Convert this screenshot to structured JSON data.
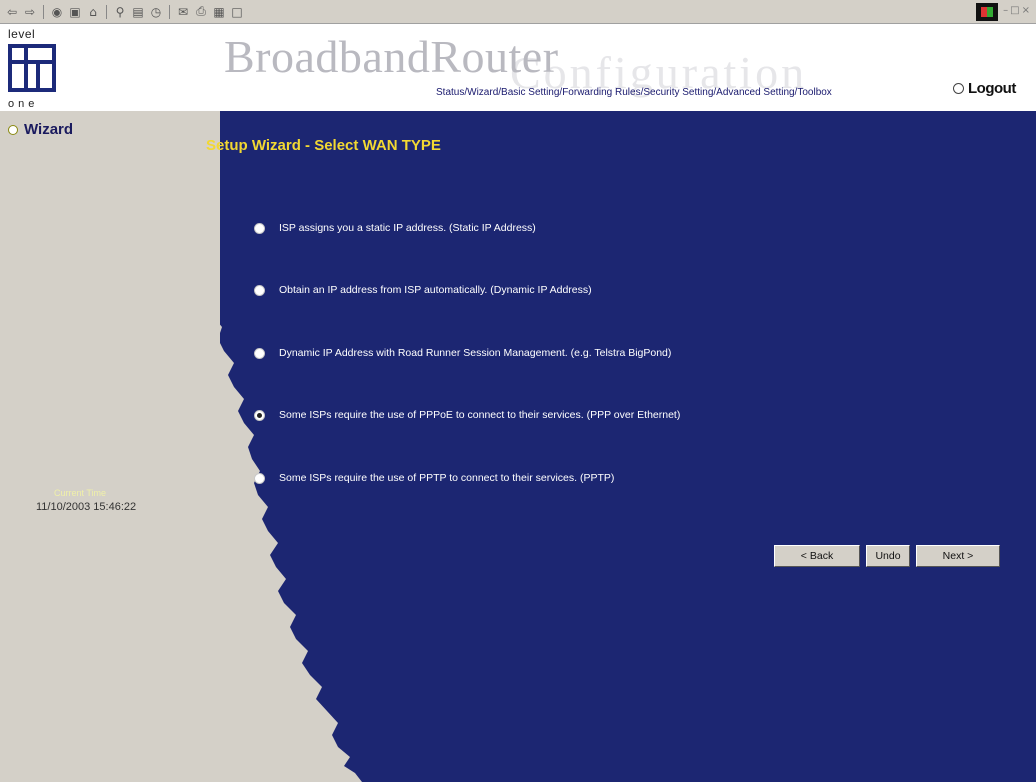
{
  "browser": {
    "toolbar_icons": [
      "back-icon",
      "forward-icon",
      "stop-icon",
      "refresh-icon",
      "home-icon",
      "search-icon",
      "favorites-icon",
      "history-icon",
      "mail-icon",
      "print-icon",
      "edit-icon",
      "discuss-icon"
    ]
  },
  "header": {
    "logo_top": "level",
    "logo_bottom": "one",
    "brand": "BroadbandRouter",
    "brand_sub": "Configuration",
    "nav": [
      "Status/",
      "Wizard/",
      "Basic Setting/",
      "Forwarding Rules/",
      "Security Setting/",
      "Advanced Setting/",
      "Toolbox"
    ],
    "logout": "Logout"
  },
  "sidebar": {
    "wizard_label": "Wizard",
    "time_label": "Current Time",
    "time_value": "11/10/2003 15:46:22"
  },
  "main": {
    "title": "Setup Wizard - Select WAN TYPE",
    "selected_index": 3,
    "options": [
      "ISP assigns you a static IP address. (Static IP Address)",
      "Obtain an IP address from ISP automatically. (Dynamic IP Address)",
      "Dynamic IP Address with Road Runner Session Management. (e.g. Telstra BigPond)",
      "Some ISPs require the use of PPPoE to connect to their services. (PPP over Ethernet)",
      "Some ISPs require the use of PPTP to connect to their services. (PPTP)"
    ],
    "buttons": {
      "back": "< Back",
      "undo": "Undo",
      "next": "Next >"
    }
  },
  "colors": {
    "panel_blue": "#1c2672",
    "title_yellow": "#f2d832",
    "sidebar_gray": "#d4d0c8"
  }
}
